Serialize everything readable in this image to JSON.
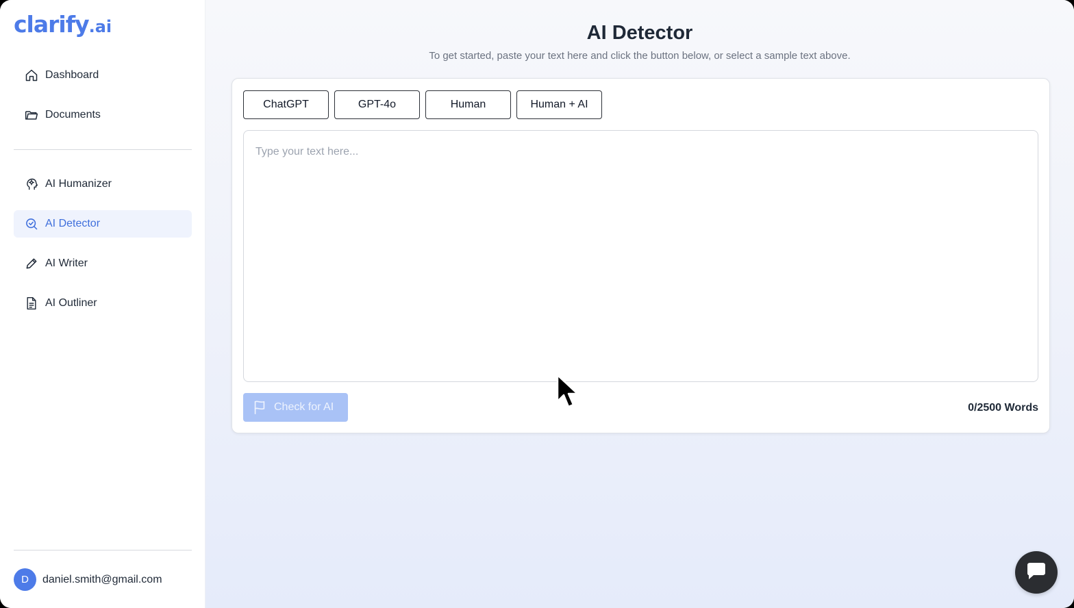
{
  "brand": {
    "name": "clarify",
    "suffix": ".ai",
    "color": "#4d7be8"
  },
  "sidebar": {
    "primary_items": [
      {
        "label": "Dashboard",
        "icon": "home-icon"
      },
      {
        "label": "Documents",
        "icon": "folder-icon"
      }
    ],
    "tool_items": [
      {
        "label": "AI Humanizer",
        "icon": "head-icon"
      },
      {
        "label": "AI Detector",
        "icon": "search-check-icon",
        "active": true
      },
      {
        "label": "AI Writer",
        "icon": "pencil-icon"
      },
      {
        "label": "AI Outliner",
        "icon": "document-icon"
      }
    ],
    "user": {
      "avatar_initial": "D",
      "email": "daniel.smith@gmail.com"
    }
  },
  "main": {
    "title": "AI Detector",
    "subtitle": "To get started, paste your text here and click the button below, or select a sample text above.",
    "sample_buttons": [
      "ChatGPT",
      "GPT-4o",
      "Human",
      "Human + AI"
    ],
    "text_input": {
      "value": "",
      "placeholder": "Type your text here..."
    },
    "check_button_label": "Check for AI",
    "word_count": "0/2500 Words"
  },
  "colors": {
    "accent": "#4d7be8",
    "active_nav_bg": "#eff3fd",
    "check_button_disabled": "#a9c2f6",
    "chat_bubble": "#2b2d31"
  }
}
